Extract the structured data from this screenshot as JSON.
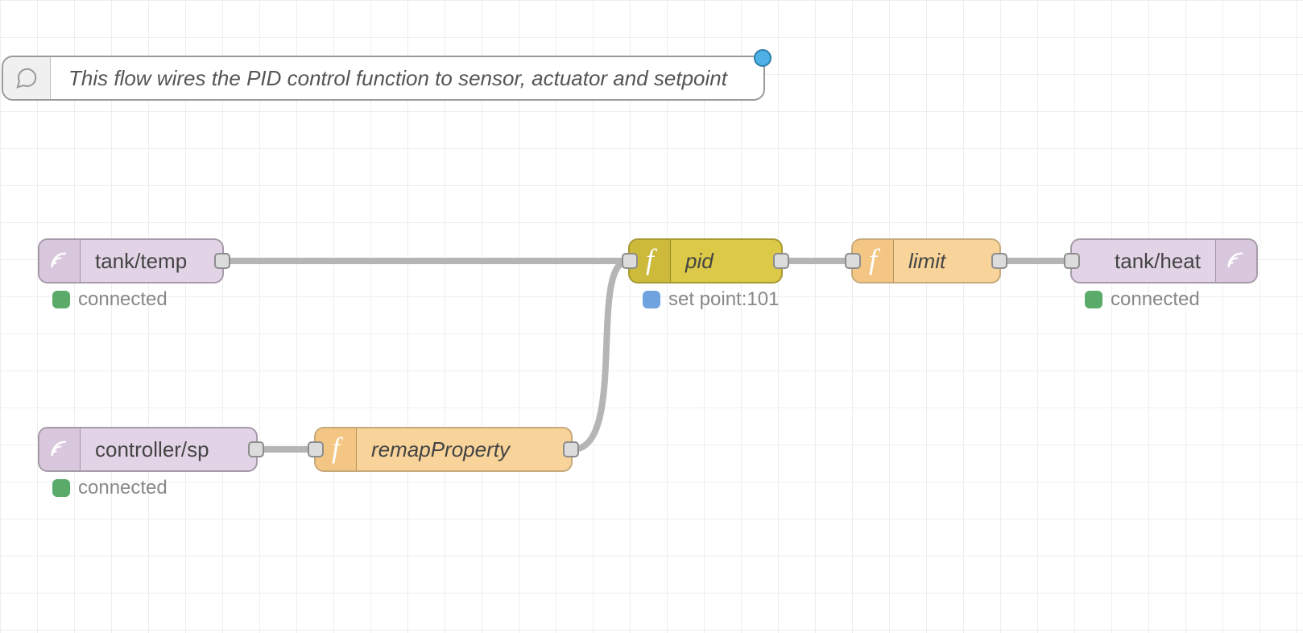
{
  "comment": {
    "text": "This flow wires the PID control function to sensor, actuator and setpoint"
  },
  "nodes": {
    "tank_temp": {
      "label": "tank/temp",
      "status": "connected"
    },
    "controller_sp": {
      "label": "controller/sp",
      "status": "connected"
    },
    "remap": {
      "label": "remapProperty"
    },
    "pid": {
      "label": "pid",
      "status": "set point:101"
    },
    "limit": {
      "label": "limit"
    },
    "tank_heat": {
      "label": "tank/heat",
      "status": "connected"
    }
  },
  "colors": {
    "mqtt": "#e2d4e6",
    "fn_orange": "#f8d49a",
    "fn_olive": "#dbc947",
    "status_green": "#5aab6a",
    "status_blue": "#6fa3e0"
  }
}
